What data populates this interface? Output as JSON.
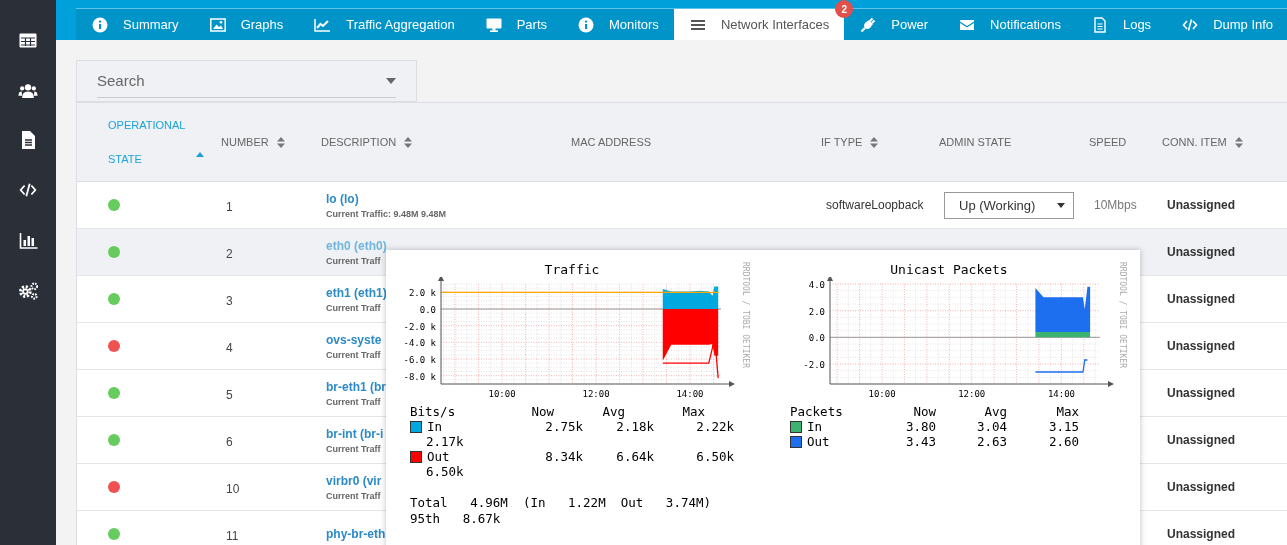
{
  "tabs": [
    {
      "label": "Summary",
      "selected": false
    },
    {
      "label": "Graphs",
      "selected": false
    },
    {
      "label": "Traffic Aggregation",
      "selected": false
    },
    {
      "label": "Parts",
      "selected": false
    },
    {
      "label": "Monitors",
      "selected": false
    },
    {
      "label": "Network Interfaces",
      "selected": true,
      "badge": "2"
    },
    {
      "label": "Power",
      "selected": false
    },
    {
      "label": "Notifications",
      "selected": false
    },
    {
      "label": "Logs",
      "selected": false
    },
    {
      "label": "Dump Info",
      "selected": false
    }
  ],
  "search": {
    "placeholder": "Search"
  },
  "table": {
    "columns": [
      {
        "label": "OPERATIONAL STATE",
        "sortable": true,
        "sorted": true
      },
      {
        "label": "NUMBER",
        "sortable": true,
        "sorted": false
      },
      {
        "label": "DESCRIPTION",
        "sortable": true,
        "sorted": false
      },
      {
        "label": "MAC ADDRESS",
        "sortable": false
      },
      {
        "label": "IF TYPE",
        "sortable": true,
        "sorted": false
      },
      {
        "label": "ADMIN STATE",
        "sortable": false
      },
      {
        "label": "SPEED",
        "sortable": false
      },
      {
        "label": "CONN. ITEM",
        "sortable": true,
        "sorted": false
      }
    ],
    "rows": [
      {
        "color": "#66cc5e",
        "number": "1",
        "name": "lo (lo)",
        "traffic": "Current Traffic: 9.48M 9.48M",
        "if_type": "softwareLoopback",
        "admin_state": "Up (Working)",
        "speed": "10Mbps",
        "conn_item": "Unassigned",
        "hovered": false
      },
      {
        "color": "#66cc5e",
        "number": "2",
        "name": "eth0 (eth0)",
        "traffic": "Current Traff",
        "conn_item": "Unassigned",
        "hovered": true
      },
      {
        "color": "#66cc5e",
        "number": "3",
        "name": "eth1 (eth1)",
        "traffic": "Current Traff",
        "conn_item": "Unassigned",
        "hovered": false
      },
      {
        "color": "#f05252",
        "number": "4",
        "name": "ovs-syste",
        "traffic": "Current Traff",
        "conn_item": "Unassigned",
        "hovered": false
      },
      {
        "color": "#66cc5e",
        "number": "5",
        "name": "br-eth1 (br",
        "traffic": "Current Traff",
        "conn_item": "Unassigned",
        "hovered": false
      },
      {
        "color": "#66cc5e",
        "number": "6",
        "name": "br-int (br-i",
        "traffic": "Current Traff",
        "conn_item": "Unassigned",
        "hovered": false
      },
      {
        "color": "#f05252",
        "number": "10",
        "name": "virbr0 (vir",
        "traffic": "Current Traff",
        "conn_item": "Unassigned",
        "hovered": false
      },
      {
        "color": "#66cc5e",
        "number": "11",
        "name": "phy-br-eth",
        "conn_item": "Unassigned",
        "hovered": false
      }
    ]
  },
  "popup": {
    "charts": [
      {
        "chart_data": {
          "type": "area",
          "title": "Traffic",
          "grid": true,
          "x": [
            8.7,
            13.38,
            13.42,
            13.6,
            13.8,
            14.0,
            14.2,
            14.4,
            14.48,
            14.52,
            14.6
          ],
          "xlim": [
            8.7,
            14.66
          ],
          "ylim": [
            -9,
            3
          ],
          "xticks": [
            {
              "value": 10,
              "label": "10:00"
            },
            {
              "value": 12,
              "label": "12:00"
            },
            {
              "value": 14,
              "label": "14:00"
            }
          ],
          "yticks": [
            {
              "value": 2,
              "label": "2.0 k"
            },
            {
              "value": 0,
              "label": "0.0"
            },
            {
              "value": -2,
              "label": "-2.0 k"
            },
            {
              "value": -4,
              "label": "-4.0 k"
            },
            {
              "value": -6,
              "label": "-6.0 k"
            },
            {
              "value": -8,
              "label": "-8.0 k"
            }
          ],
          "series": [
            {
              "name": "In",
              "color": "#00a8e0",
              "values": [
                null,
                null,
                2.4,
                2.1,
                2.1,
                2.1,
                2.2,
                2.1,
                1.6,
                2.7,
                2.7
              ]
            },
            {
              "name": "Out",
              "color": "#ff0000",
              "values": [
                null,
                null,
                -6.2,
                -4.3,
                -4.3,
                -4.3,
                -4.3,
                -4.3,
                -4.2,
                -5.6,
                -5.6
              ]
            },
            {
              "color": "#ff0000",
              "type": "line",
              "values": [
                null,
                null,
                -6.5,
                -6.5,
                -6.5,
                -6.5,
                -6.5,
                -6.5,
                -4.6,
                -3.0,
                -8.3
              ]
            },
            {
              "color": "#ffa500",
              "type": "line",
              "values": [
                2,
                2,
                2,
                2,
                2,
                2,
                2,
                2,
                2,
                2,
                2
              ]
            }
          ]
        },
        "credit": "RRDTOOL / TOBI OETIKER",
        "legend": {
          "header": [
            "Bits/s",
            "Now",
            "Avg",
            "Max"
          ],
          "rows": [
            {
              "values": [
                "2.75k",
                "2.18k",
                "2.22k"
              ],
              "extra": "2.17k"
            },
            {
              "values": [
                "8.34k",
                "6.64k",
                "6.50k"
              ],
              "extra": "6.50k"
            }
          ]
        },
        "footer": [
          "Total   4.96M  (In   1.22M  Out   3.74M)",
          "95th   8.67k"
        ]
      },
      {
        "chart_data": {
          "type": "area",
          "title": "Unicast Packets",
          "stacked": true,
          "grid": true,
          "x": [
            13.42,
            13.6,
            14.0,
            14.4,
            14.48,
            14.52,
            14.58,
            14.64
          ],
          "xlim": [
            8.84,
            14.86
          ],
          "ylim": [
            -3.5,
            4.0
          ],
          "xticks": [
            {
              "value": 10,
              "label": "10:00"
            },
            {
              "value": 12,
              "label": "12:00"
            },
            {
              "value": 14,
              "label": "14:00"
            }
          ],
          "yticks": [
            {
              "value": 4,
              "label": "4.0"
            },
            {
              "value": 2,
              "label": "2.0"
            },
            {
              "value": 0,
              "label": "0.0"
            },
            {
              "value": -2,
              "label": "-2.0"
            }
          ],
          "series": [
            {
              "name": "In",
              "color": "#3cb371",
              "values": [
                0.4,
                0.4,
                0.4,
                0.4,
                0.4,
                0.4,
                0.4,
                0.4
              ]
            },
            {
              "name": "Out",
              "color": "#1e6ef0",
              "values": [
                3.3,
                2.6,
                2.6,
                2.6,
                2.6,
                1.7,
                3.4,
                3.4
              ]
            },
            {
              "color": "#1e6ef0",
              "type": "line",
              "values": [
                -2.6,
                -2.6,
                -2.6,
                -2.6,
                -2.6,
                -1.7,
                -1.7,
                null
              ]
            }
          ]
        },
        "credit": "RRDTOOL / TOBI OETIKER",
        "legend": {
          "header": [
            "Packets",
            "Now",
            "Avg",
            "Max"
          ],
          "rows": [
            {
              "values": [
                "3.80",
                "3.04",
                "3.15"
              ]
            },
            {
              "values": [
                "3.43",
                "2.63",
                "2.60"
              ]
            }
          ]
        }
      }
    ]
  }
}
